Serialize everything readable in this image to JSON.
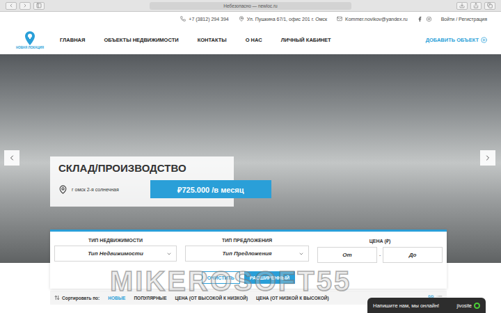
{
  "browser": {
    "address": "Небезопасно — newloc.ru"
  },
  "topbar": {
    "phone": "+7 (3812) 294 394",
    "address": "Ул. Пушкина 67/1, офис 201 г. Омск",
    "email": "Kommer.novikov@yandex.ru",
    "login": "Войти / Регистрация"
  },
  "logo": {
    "text": "НОВАЯ ЛОКАЦИЯ"
  },
  "nav": {
    "items": [
      "ГЛАВНАЯ",
      "ОБЪЕКТЫ НЕДВИЖИМОСТИ",
      "КОНТАКТЫ",
      "О НАС",
      "ЛИЧНЫЙ КАБИНЕТ"
    ],
    "add_button": "ДОБАВИТЬ ОБЪЕКТ"
  },
  "slide": {
    "title": "СКЛАД/ПРОИЗВОДСТВО",
    "location": "г омск 2-я солнечная",
    "price": "₽725.000 /в месяц"
  },
  "search": {
    "fields": [
      {
        "label": "ТИП НЕДВИЖИМОСТИ",
        "placeholder": "Тип Недвижимости"
      },
      {
        "label": "ТИП ПРЕДЛОЖЕНИЯ",
        "placeholder": "Тип Предложения"
      }
    ],
    "price": {
      "label": "ЦЕНА (₽)",
      "from": "От",
      "separator": "-",
      "to": "До"
    },
    "buttons": [
      {
        "label": "ОЧИСТИТЬ",
        "kind": "outline"
      },
      {
        "label": "РАСШИРЕННЫЙ",
        "kind": "primary"
      }
    ]
  },
  "sort": {
    "label": "Сортировать по:",
    "options": [
      {
        "label": "НОВЫЕ",
        "selected": true
      },
      {
        "label": "ПОПУЛЯРНЫЕ",
        "selected": false
      },
      {
        "label": "ЦЕНА (ОТ ВЫСОКОЙ К НИЗКОЙ)",
        "selected": false
      },
      {
        "label": "ЦЕНА (ОТ НИЗКОЙ К ВЫСОКОЙ)",
        "selected": false
      }
    ],
    "views": [
      {
        "kind": "grid",
        "selected": true
      },
      {
        "kind": "list",
        "selected": false
      }
    ]
  },
  "watermark": "MIKEROSOFT55",
  "chat": {
    "text": "Напишите нам, мы онлайн!",
    "brand": "jivosite"
  }
}
